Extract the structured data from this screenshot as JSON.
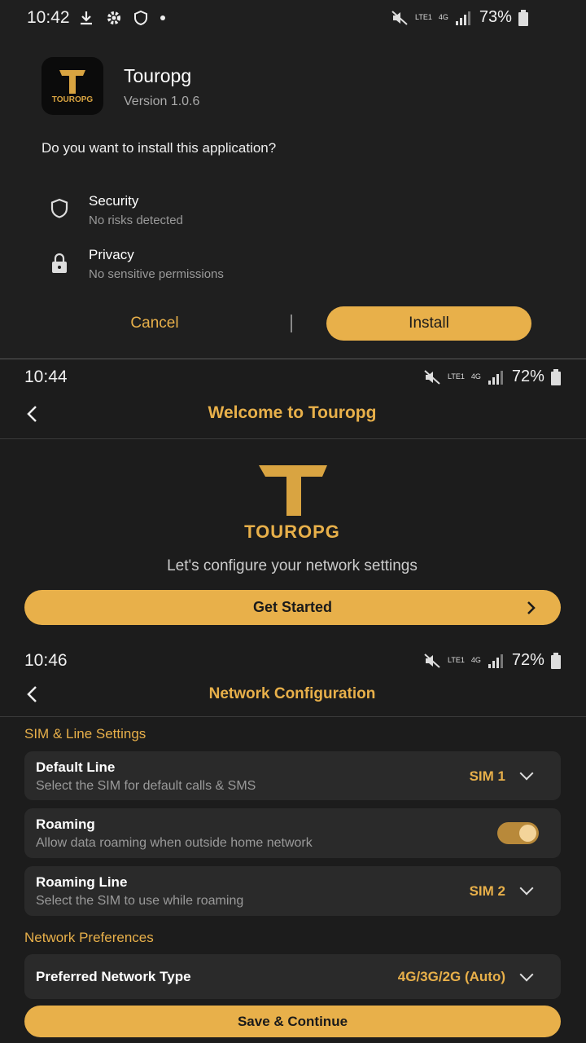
{
  "install_dialog": {
    "status": {
      "time": "10:42",
      "battery": "73%",
      "lte": "LTE1",
      "network": "4G"
    },
    "app_name": "Touropg",
    "version": "Version 1.0.6",
    "icon_text": "TOUROPG",
    "prompt": "Do you want to install this application?",
    "security_title": "Security",
    "security_sub": "No risks detected",
    "privacy_title": "Privacy",
    "privacy_sub": "No sensitive permissions",
    "cancel_label": "Cancel",
    "install_label": "Install"
  },
  "welcome": {
    "status": {
      "time": "10:44",
      "battery": "72%",
      "lte": "LTE1",
      "network": "4G"
    },
    "title": "Welcome to Touropg",
    "logo_text": "TOUROPG",
    "subtitle": "Let's configure your network settings",
    "cta": "Get Started"
  },
  "network_config": {
    "status": {
      "time": "10:46",
      "battery": "72%",
      "lte": "LTE1",
      "network": "4G"
    },
    "title": "Network Configuration",
    "section1": "SIM & Line Settings",
    "default_line": {
      "title": "Default Line",
      "sub": "Select the SIM for default calls & SMS",
      "value": "SIM 1"
    },
    "roaming": {
      "title": "Roaming",
      "sub": "Allow data roaming when outside home network",
      "enabled": true
    },
    "roaming_line": {
      "title": "Roaming Line",
      "sub": "Select the SIM to use while roaming",
      "value": "SIM 2"
    },
    "section2": "Network Preferences",
    "preferred": {
      "title": "Preferred Network Type",
      "value": "4G/3G/2G (Auto)"
    },
    "save": "Save & Continue"
  },
  "colors": {
    "accent": "#e8b04a",
    "bg": "#1e1e1e",
    "card": "#2a2a2a"
  }
}
